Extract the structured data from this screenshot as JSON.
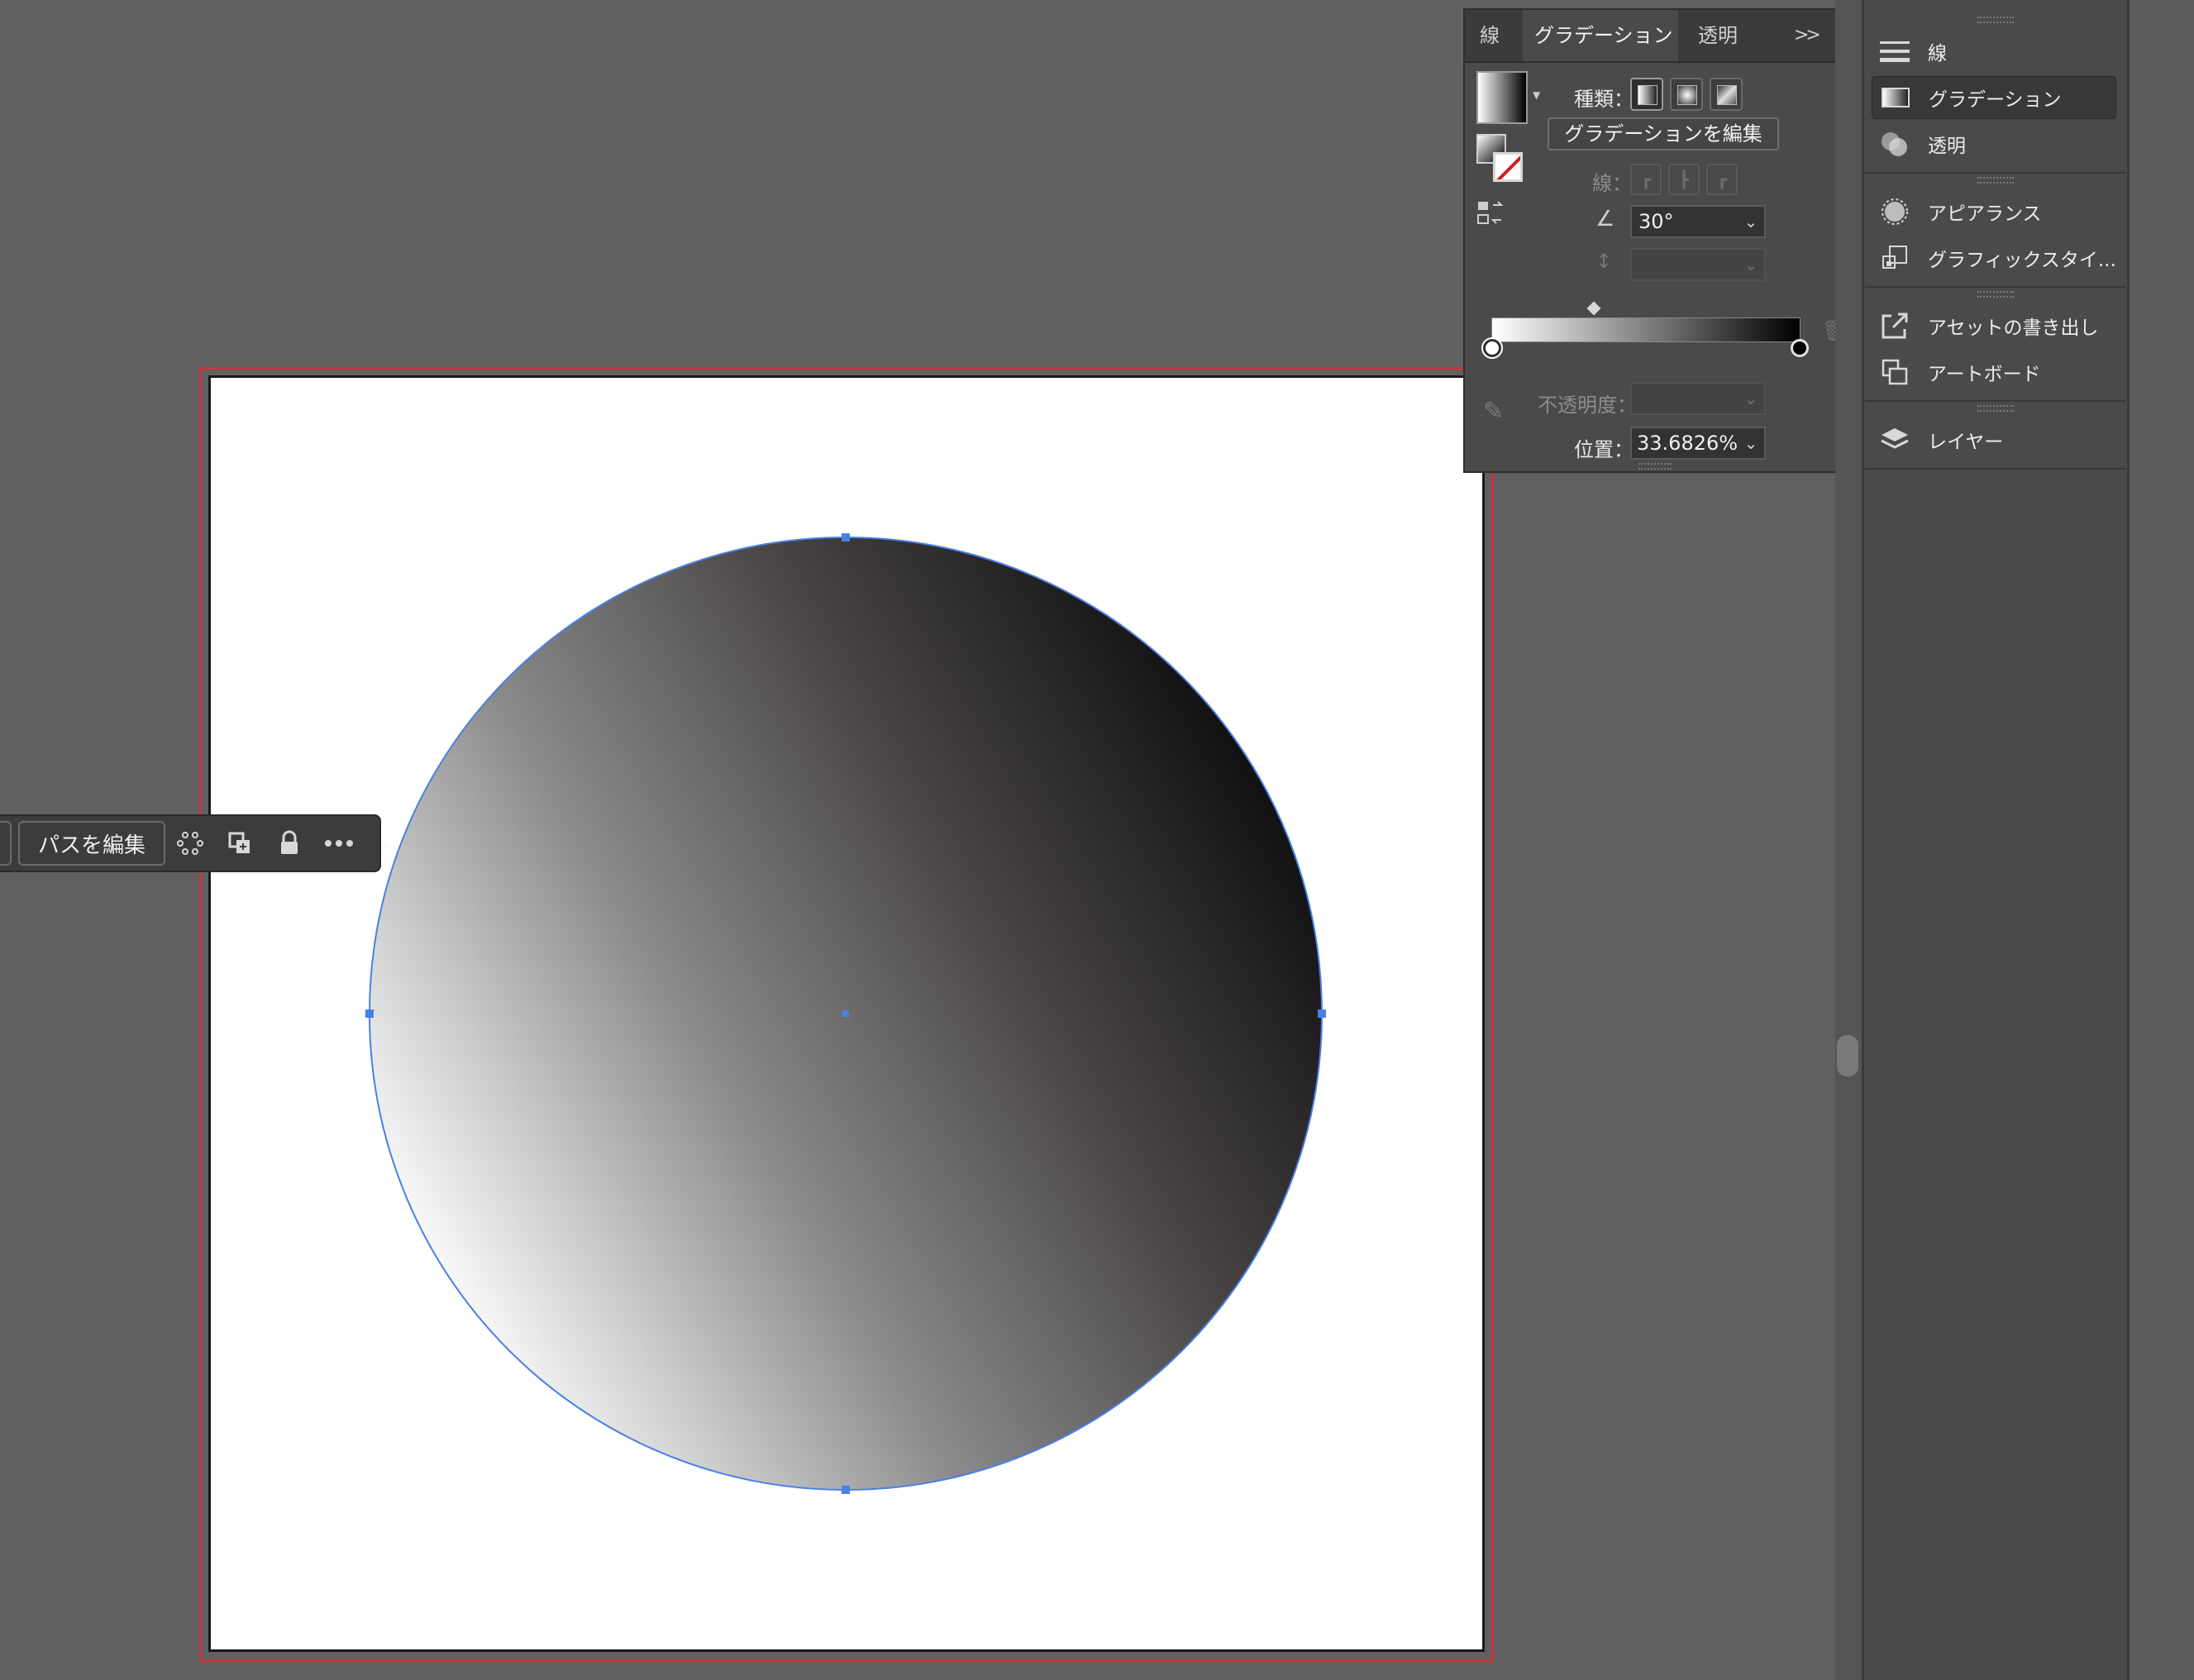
{
  "gradient_panel": {
    "tabs": {
      "stroke": "線",
      "gradient": "グラデーション",
      "transparency": "透明",
      "overflow": ">>",
      "menu": "≡"
    },
    "type_label": "種類：",
    "type_options": [
      "linear-gradient-icon",
      "radial-gradient-icon",
      "freeform-gradient-icon"
    ],
    "edit_button": "グラデーションを編集",
    "stroke_label": "線：",
    "angle_value": "30°",
    "aspect_value": "",
    "opacity_label": "不透明度：",
    "opacity_value": "",
    "location_label": "位置：",
    "location_value": "33.6826%",
    "slider_stops": [
      "#ffffff",
      "#000000"
    ],
    "midpoint_position_percent": 33.68
  },
  "taskbar": {
    "edit_path_label": "パスを編集"
  },
  "dock": {
    "items": [
      {
        "label": "線",
        "icon": "stroke-lines-icon"
      },
      {
        "label": "グラデーション",
        "icon": "gradient-icon",
        "selected": true
      },
      {
        "label": "透明",
        "icon": "transparency-icon"
      },
      {
        "label": "アピアランス",
        "icon": "appearance-icon"
      },
      {
        "label": "グラフィックスタイ...",
        "icon": "graphic-styles-icon"
      },
      {
        "label": "アセットの書き出し",
        "icon": "asset-export-icon"
      },
      {
        "label": "アートボード",
        "icon": "artboards-icon"
      },
      {
        "label": "レイヤー",
        "icon": "layers-icon"
      }
    ]
  },
  "colors": {
    "artboard_border": "#c8353b",
    "selection": "#4a7fe8",
    "ui_bg": "#606060",
    "panel_bg": "#4a4a4a"
  },
  "artwork": {
    "shape": "circle",
    "fill": "linear-gradient",
    "angle_deg": 30,
    "gradient_from": "#ffffff",
    "gradient_to": "#000000"
  }
}
